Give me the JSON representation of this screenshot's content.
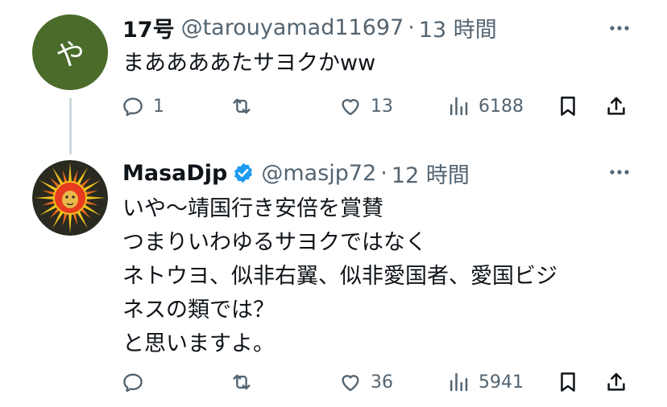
{
  "colors": {
    "text": "#0f1419",
    "secondary": "#536471",
    "verified": "#1d9bf0",
    "thread_line": "#cfd9de",
    "avatar_bg": "#4a6b2a"
  },
  "posts": [
    {
      "avatar_letter": "や",
      "name": "17号",
      "handle": "@tarouyamad11697",
      "separator": "·",
      "time": "13 時間",
      "verified": false,
      "lines": [
        "まああああたサヨクかww"
      ],
      "actions": {
        "reply_count": "1",
        "repost_count": "",
        "like_count": "13",
        "view_count": "6188"
      }
    },
    {
      "name": "MasaDjp",
      "handle": "@masjp72",
      "separator": "·",
      "time": "12 時間",
      "verified": true,
      "lines": [
        "いや〜靖国行き安倍を賞賛",
        "つまりいわゆるサヨクではなく",
        "ネトウヨ、似非右翼、似非愛国者、愛国ビジ",
        "ネスの類では？",
        "と思いますよ。"
      ],
      "actions": {
        "reply_count": "",
        "repost_count": "",
        "like_count": "36",
        "view_count": "5941"
      }
    }
  ],
  "icons": [
    "reply-icon",
    "repost-icon",
    "like-icon",
    "views-icon",
    "bookmark-icon",
    "share-icon",
    "more-icon",
    "verified-badge-icon"
  ]
}
